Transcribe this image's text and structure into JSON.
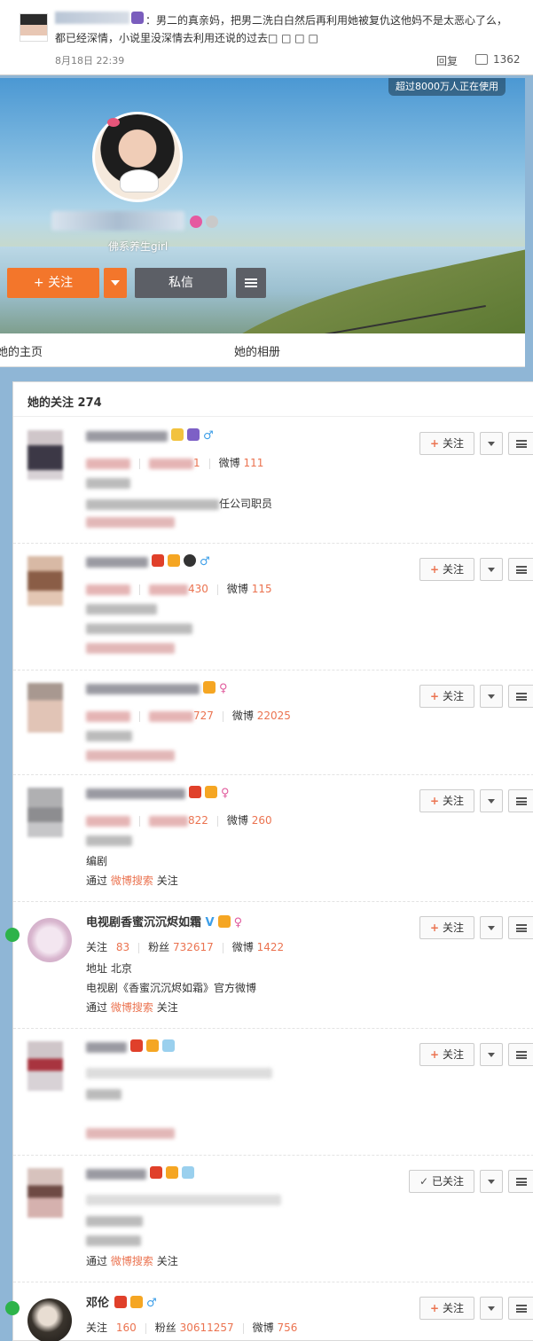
{
  "comment": {
    "text_line1": "：男二的真亲妈，把男二洗白白然后再利用她被复仇这他妈不是太恶心了么，",
    "text_line2": "都已经深情，小说里没深情去利用还说的过去□ □ □ □",
    "date": "8月18日 22:39",
    "reply_label": "回复",
    "like_count": "1362"
  },
  "profile": {
    "users_badge": "超过8000万人正在使用",
    "bio": "佛系养生girl",
    "follow_label": "关注",
    "message_label": "私信"
  },
  "tabs": {
    "home": "她的主页",
    "album": "她的相册"
  },
  "follow_list": {
    "title": "她的关注 274",
    "follow_label": "关注",
    "following_label": "已关注",
    "labels": {
      "following": "关注",
      "fans": "粉丝",
      "weibo": "微博",
      "address": "地址",
      "via": "通过",
      "via_suffix": "关注"
    },
    "items": [
      {
        "fans_tail": "1",
        "weibo": "111",
        "desc": "任公司职员"
      },
      {
        "fans_tail": "430",
        "weibo": "115"
      },
      {
        "fans_tail": "727",
        "weibo": "22025"
      },
      {
        "fans_tail": "822",
        "weibo": "260",
        "desc": "编剧",
        "via_source": "微博搜索"
      },
      {
        "name": "电视剧香蜜沉沉烬如霜",
        "following": "83",
        "fans": "732617",
        "weibo": "1422",
        "address": "北京",
        "desc": "电视剧《香蜜沉沉烬如霜》官方微博",
        "via_source": "微博搜索"
      },
      {},
      {
        "via_source": "微博搜索"
      },
      {
        "name": "邓伦",
        "following": "160",
        "fans": "30611257",
        "weibo": "756"
      }
    ]
  }
}
